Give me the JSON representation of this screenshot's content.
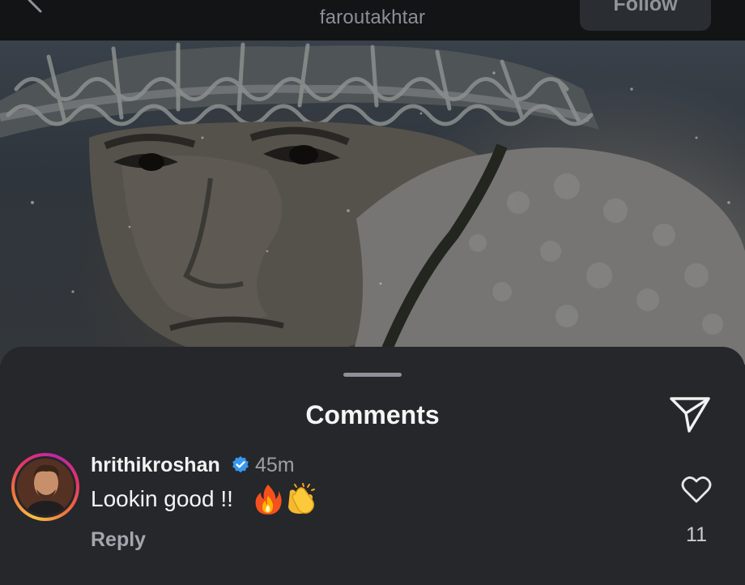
{
  "topbar": {
    "username": "faroutakhtar",
    "follow_label": "Follow",
    "back_icon": "chevron-left-icon"
  },
  "post": {
    "image_description_icon": "soldier-photo"
  },
  "comments_sheet": {
    "title": "Comments",
    "share_icon": "paper-plane-icon",
    "comments": [
      {
        "username": "hrithikroshan",
        "verified": true,
        "time": "45m",
        "text": "Lookin good !!",
        "emojis": [
          "fire-emoji",
          "clapping-hands-emoji"
        ],
        "reply_label": "Reply",
        "likes": "11"
      }
    ]
  },
  "colors": {
    "background": "#25272b",
    "topbar": "#121416",
    "verified_blue": "#3897f0",
    "text_primary": "#f4f4f4",
    "text_secondary": "#9ca0a6"
  }
}
